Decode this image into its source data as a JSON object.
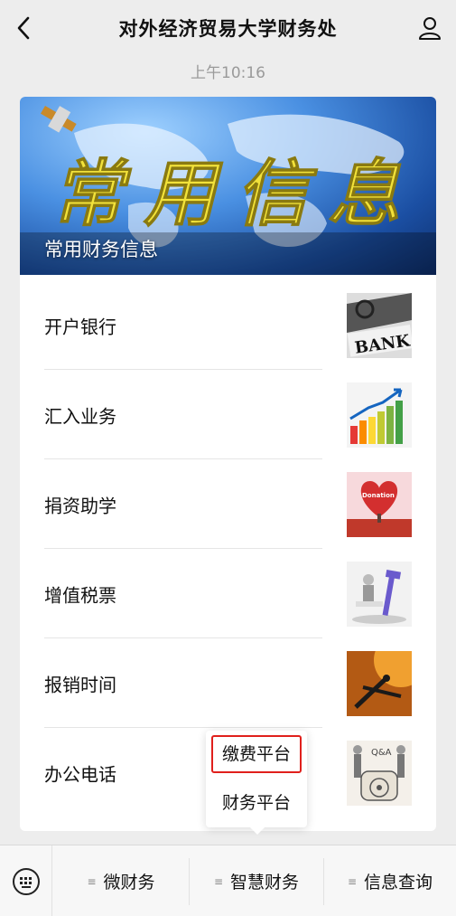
{
  "header": {
    "title": "对外经济贸易大学财务处"
  },
  "chat": {
    "timestamp": "上午10:16"
  },
  "article": {
    "banner_title": "常用财务信息",
    "banner_art_text": "常用信息",
    "items": [
      {
        "label": "开户银行",
        "thumb_text": "BANK"
      },
      {
        "label": "汇入业务",
        "thumb_text": ""
      },
      {
        "label": "捐资助学",
        "thumb_text": "Donation"
      },
      {
        "label": "增值税票",
        "thumb_text": ""
      },
      {
        "label": "报销时间",
        "thumb_text": ""
      },
      {
        "label": "办公电话",
        "thumb_text": "Q&A"
      }
    ]
  },
  "popup_menu": {
    "items": [
      "缴费平台",
      "财务平台"
    ]
  },
  "tabbar": {
    "tabs": [
      "微财务",
      "智慧财务",
      "信息查询"
    ],
    "menu_glyph": "≡"
  }
}
